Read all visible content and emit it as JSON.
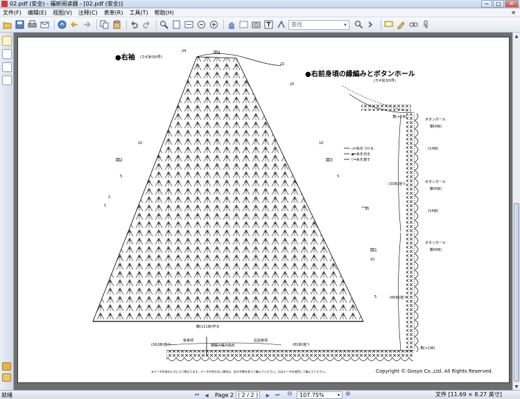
{
  "window": {
    "title": "02.pdf (安全) - 福昕阅读器 - [02.pdf (安全)]",
    "controls": {
      "minimize": "−",
      "maximize": "□",
      "close": "✕"
    }
  },
  "menu": {
    "items": [
      "文件(F)",
      "编辑(E)",
      "视图(V)",
      "注释(C)",
      "表单(R)",
      "工具(T)",
      "帮助(H)"
    ],
    "close_x": "✕"
  },
  "toolbar": {
    "search_placeholder": "查找",
    "search_dropdown": "▾",
    "icons": [
      "open-icon",
      "save-icon",
      "print-icon",
      "email-icon",
      "home-icon",
      "back-icon",
      "forward-icon",
      "copy-icon",
      "paste-icon",
      "undo-icon",
      "redo-icon",
      "zoom-icon",
      "fit-page-icon",
      "fit-width-icon",
      "zoom-out-icon",
      "zoom-in-icon",
      "hand-icon",
      "select-icon",
      "snapshot-icon",
      "text-tool-icon",
      "typewriter-icon",
      "search-icon"
    ]
  },
  "status": {
    "left_text": "就绪",
    "page_label": "Page 2",
    "page_box": "( 2 / 2 )",
    "zoom": "107.75%",
    "file_info": "文件 [11.69 × 8.27 英寸]"
  },
  "document": {
    "sleeve_title": "●右袖",
    "sleeve_hook": "(カギ針3/0号)",
    "edging_title": "●右前身頃の縁編みとボタンホール",
    "edging_hook": "(カギ針3/0号)",
    "legend": [
      "◁=糸をつける",
      "◀=糸を切る",
      "▽=糸を渡す"
    ],
    "labels": {
      "fig2": "図2",
      "fig3": "図3",
      "fig1": "図1",
      "fig4": "図4",
      "kakumoku_top": "角(+1目)",
      "kakumoku_bottom": "角(+1目)",
      "buttonhole": "ボタンホール",
      "buttonhole_stitches": "鎖(6目)",
      "gap14": "(14目)",
      "pick33": "(33目)拾う",
      "pick66": "(66目)拾う",
      "chain_start": "鎖(111目)作る",
      "back_body": "後身頃",
      "right_front": "右前身頃",
      "edging_start": "縁編み編み始め",
      "pick162": "(162目)拾う",
      "pick81": "(81目)拾う",
      "copyright": "Copyright © Gosyo Co.,Ltd. All Rights Reserved.",
      "footnote": "★データ作成のときにより異なります。データが合わない場合は、針の号数を変えて編んでください。元はデータを使用して編んでください。",
      "row_24": "24",
      "row_22": "22",
      "row_20": "20",
      "row_10a": "10",
      "row_10b": "10",
      "row_5a": "5",
      "row_5b": "5",
      "row_2": "2",
      "row_1": "1",
      "row_30": "30",
      "row_10c": "10",
      "row_5c": "5"
    }
  }
}
